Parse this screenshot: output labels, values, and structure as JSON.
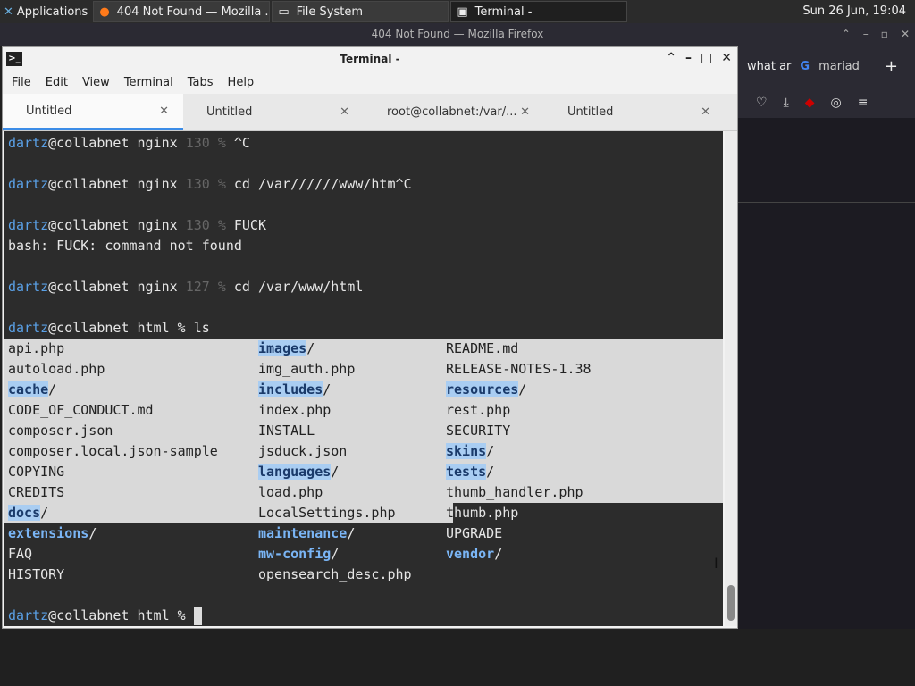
{
  "top_panel": {
    "apps_label": "Applications",
    "tasks": [
      {
        "title": "404 Not Found — Mozilla ...",
        "icon": "firefox-icon"
      },
      {
        "title": "File System",
        "icon": "folder-icon"
      },
      {
        "title": "Terminal -",
        "icon": "terminal-icon"
      }
    ],
    "clock": "Sun 26 Jun, 19:04"
  },
  "firefox": {
    "title": "404 Not Found — Mozilla Firefox",
    "tab1": "what ar",
    "tab2": "mariad"
  },
  "terminal": {
    "title": "Terminal -",
    "menu": [
      "File",
      "Edit",
      "View",
      "Terminal",
      "Tabs",
      "Help"
    ],
    "tabs": [
      "Untitled",
      "Untitled",
      "root@collabnet:/var/...",
      "Untitled"
    ],
    "user": "dartz",
    "host": "@collabnet",
    "prompt_lines": [
      {
        "dir": "nginx",
        "code": "130",
        "cmd": "^C"
      },
      {
        "dir": "nginx",
        "code": "130",
        "cmd": "cd /var//////www/htm^C"
      },
      {
        "dir": "nginx",
        "code": "130",
        "cmd": "FUCK"
      },
      {
        "dir": "nginx",
        "code": "127",
        "cmd": "cd /var/www/html"
      },
      {
        "dir": "html",
        "code": "",
        "cmd": "ls"
      }
    ],
    "error": "bash: FUCK: command not found",
    "final_prompt": "dartz@collabnet html % ",
    "ls": [
      [
        "api.php",
        "images/",
        "README.md"
      ],
      [
        "autoload.php",
        "img_auth.php",
        "RELEASE-NOTES-1.38"
      ],
      [
        "cache/",
        "includes/",
        "resources/"
      ],
      [
        "CODE_OF_CONDUCT.md",
        "index.php",
        "rest.php"
      ],
      [
        "composer.json",
        "INSTALL",
        "SECURITY"
      ],
      [
        "composer.local.json-sample",
        "jsduck.json",
        "skins/"
      ],
      [
        "COPYING",
        "languages/",
        "tests/"
      ],
      [
        "CREDITS",
        "load.php",
        "thumb_handler.php"
      ],
      [
        "docs/",
        "LocalSettings.php",
        "thumb.php"
      ],
      [
        "extensions/",
        "maintenance/",
        "UPGRADE"
      ],
      [
        "FAQ",
        "mw-config/",
        "vendor/"
      ],
      [
        "HISTORY",
        "opensearch_desc.php",
        ""
      ]
    ]
  }
}
